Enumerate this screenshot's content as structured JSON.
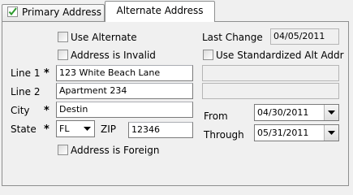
{
  "tabs": [
    {
      "label": "Primary Address",
      "checked": true
    },
    {
      "label": "Alternate Address",
      "active": true
    }
  ],
  "form": {
    "use_alternate_label": "Use Alternate",
    "address_invalid_label": "Address is Invalid",
    "last_change_label": "Last Change",
    "last_change_value": "04/05/2011",
    "use_standardized_label": "Use Standardized Alt Addr",
    "line1_label": "Line 1",
    "line1_value": "123 White Beach Lane",
    "line2_label": "Line 2",
    "line2_value": "Apartment 234",
    "city_label": "City",
    "city_value": "Destin",
    "state_label": "State",
    "state_value": "FL",
    "zip_label": "ZIP",
    "zip_value": "12346",
    "address_foreign_label": "Address is Foreign",
    "from_label": "From",
    "from_value": "04/30/2011",
    "through_label": "Through",
    "through_value": "05/31/2011",
    "required_marker": "*",
    "std_line1_value": "",
    "std_line2_value": ""
  },
  "colors": {
    "border": "#8e8f8f",
    "field_bg": "#ffffff",
    "panel_bg": "#f0f0f0",
    "check_green": "#2e9b2e"
  }
}
